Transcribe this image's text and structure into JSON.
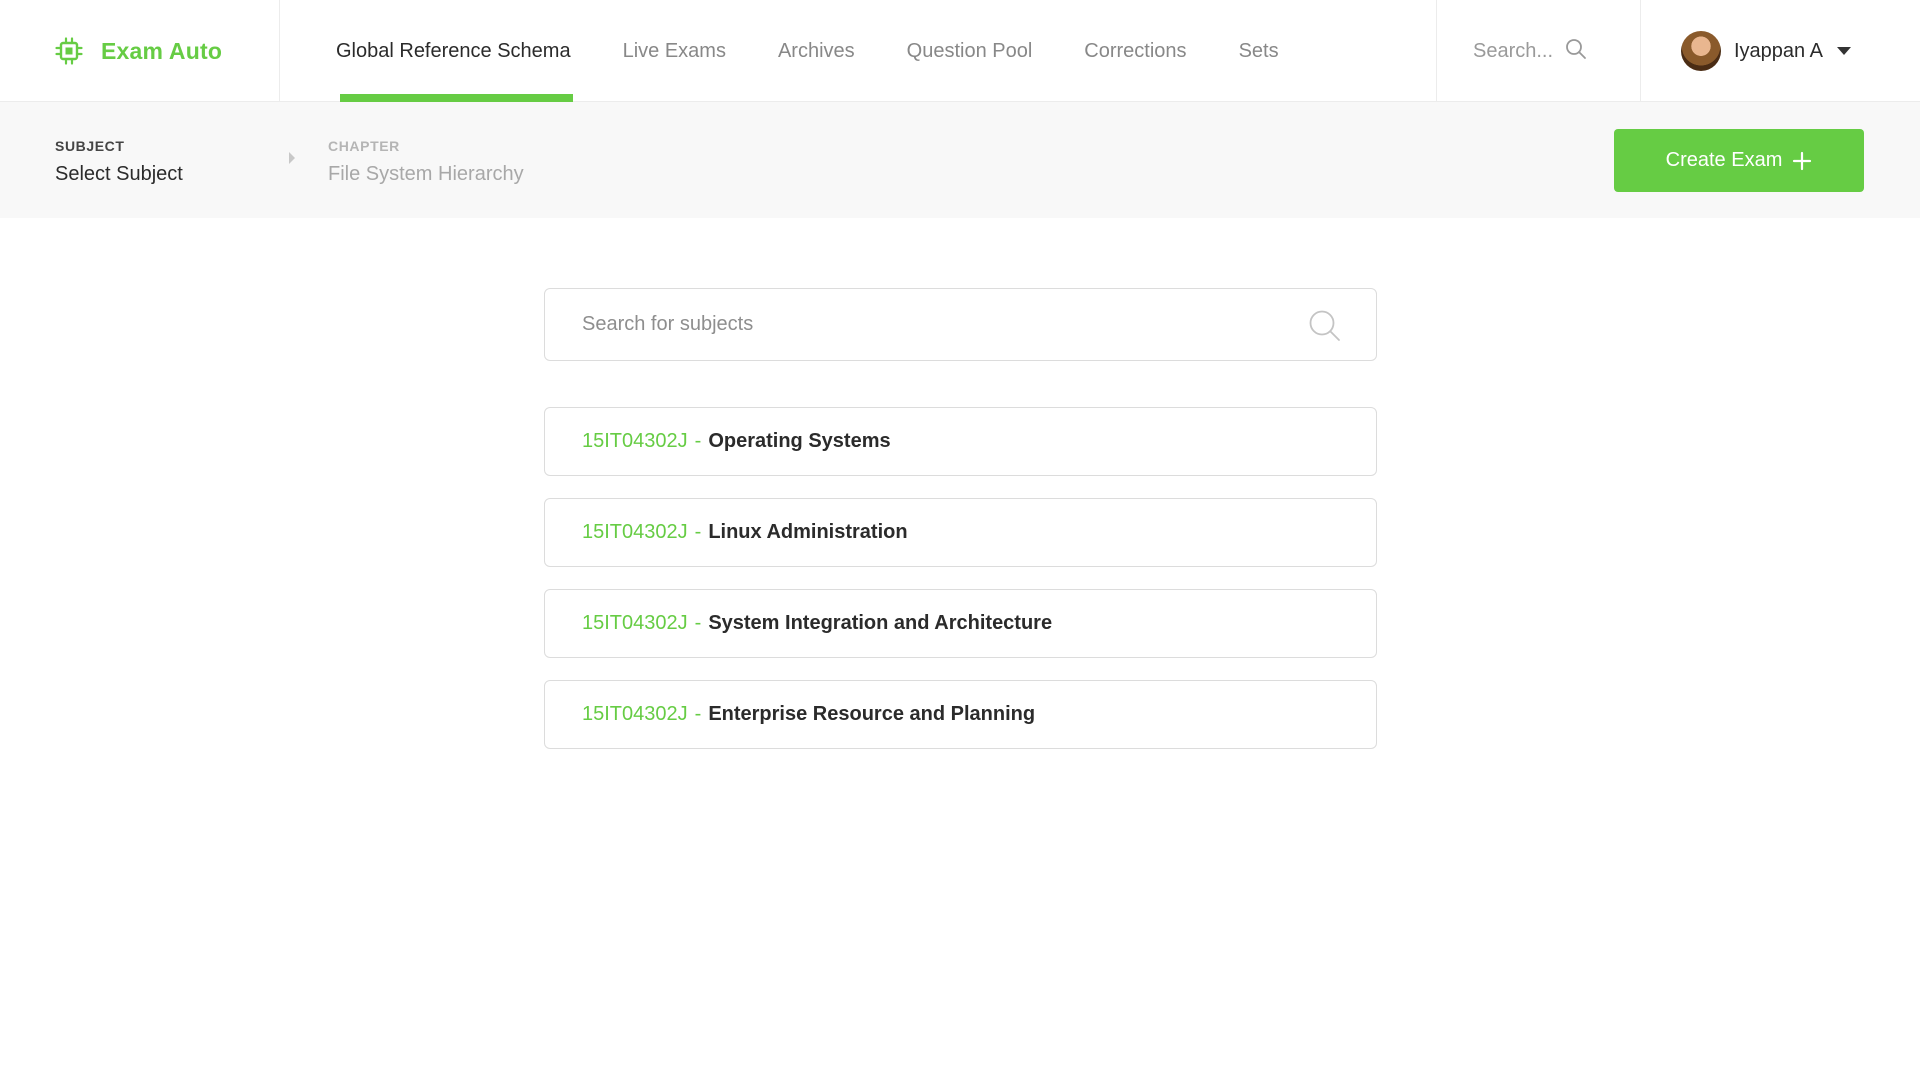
{
  "app": {
    "name": "Exam Auto",
    "logo_icon": "cpu-chip-icon",
    "accent_color": "#66cc44"
  },
  "nav": {
    "tabs": [
      {
        "label": "Global Reference Schema",
        "active": true
      },
      {
        "label": "Live Exams",
        "active": false
      },
      {
        "label": "Archives",
        "active": false
      },
      {
        "label": "Question Pool",
        "active": false
      },
      {
        "label": "Corrections",
        "active": false
      },
      {
        "label": "Sets",
        "active": false
      }
    ],
    "search_placeholder": "Search...",
    "user": {
      "name": "Iyappan A"
    }
  },
  "breadcrumb": {
    "subject": {
      "label": "SUBJECT",
      "value": "Select Subject"
    },
    "chapter": {
      "label": "CHAPTER",
      "value": "File System Hierarchy"
    }
  },
  "actions": {
    "create_exam_label": "Create Exam"
  },
  "subject_search": {
    "placeholder": "Search for subjects"
  },
  "subjects": [
    {
      "code": "15IT04302J",
      "separator": "-",
      "name": "Operating Systems"
    },
    {
      "code": "15IT04302J",
      "separator": "-",
      "name": "Linux Administration"
    },
    {
      "code": "15IT04302J",
      "separator": "-",
      "name": "System Integration and Architecture"
    },
    {
      "code": "15IT04302J",
      "separator": "-",
      "name": "Enterprise Resource and Planning"
    }
  ]
}
